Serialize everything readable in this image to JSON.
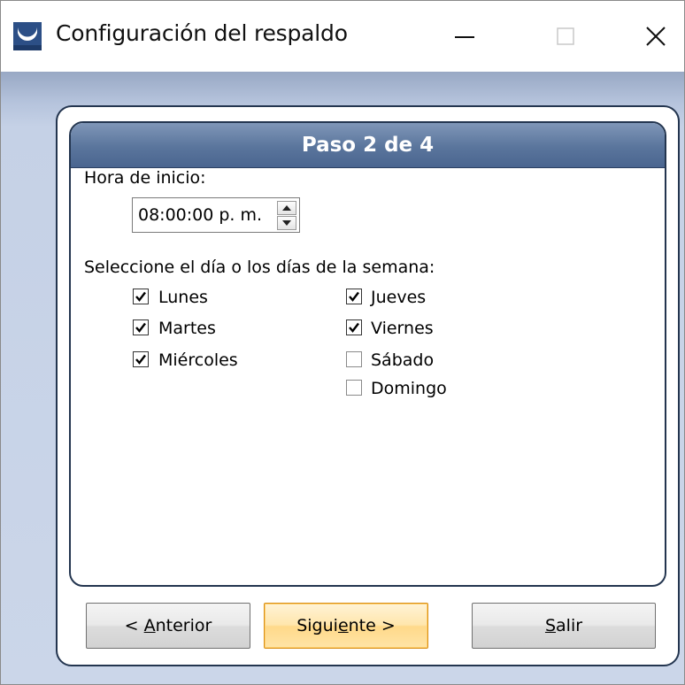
{
  "window": {
    "title": "Configuración del respaldo",
    "icons": {
      "app": "app-logo-icon",
      "minimize": "minimize-icon",
      "maximize": "maximize-icon",
      "close": "close-icon"
    }
  },
  "step": {
    "title": "Paso 2 de 4"
  },
  "start_time": {
    "label": "Hora de inicio:",
    "value": "08:00:00 p. m."
  },
  "days": {
    "label": "Seleccione el día o los días de la semana:",
    "items": [
      {
        "label": "Lunes",
        "checked": true
      },
      {
        "label": "Martes",
        "checked": true
      },
      {
        "label": "Miércoles",
        "checked": true
      },
      {
        "label": "Jueves",
        "checked": true
      },
      {
        "label": "Viernes",
        "checked": true
      },
      {
        "label": "Sábado",
        "checked": false
      },
      {
        "label": "Domingo",
        "checked": false
      }
    ]
  },
  "buttons": {
    "back": {
      "pre": "< ",
      "mnemonic": "A",
      "post": "nterior"
    },
    "next": {
      "pre": "Sigui",
      "mnemonic": "e",
      "post": "nte >"
    },
    "exit": {
      "pre": "",
      "mnemonic": "S",
      "post": "alir"
    }
  },
  "colors": {
    "panel_border": "#23354f",
    "header_blue": "#5a759c",
    "client_background": "#cbd6e9",
    "default_button_border": "#d88f16"
  }
}
